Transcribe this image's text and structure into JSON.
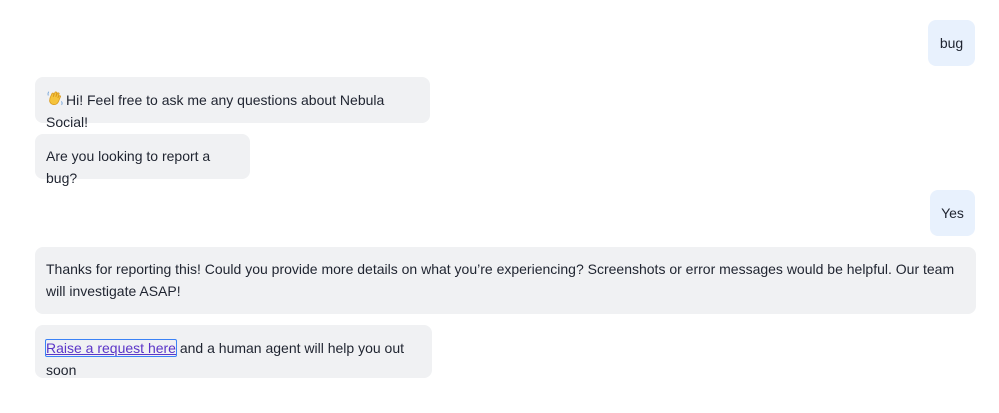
{
  "messages": {
    "user_bug": "bug",
    "bot_greeting": "Hi! Feel free to ask me any questions about Nebula Social!",
    "bot_question": "Are you looking to report a bug?",
    "user_yes": "Yes",
    "bot_thanks": "Thanks for reporting this! Could you provide more details on what you’re experiencing? Screenshots or error messages would be helpful. Our team will investigate ASAP!",
    "bot_request": {
      "link_label": "Raise a request here",
      "suffix": " and a human agent will help you out soon"
    }
  },
  "icons": {
    "greeting_icon": "waving-hand-icon"
  },
  "colors": {
    "bot_bubble": "#f0f1f3",
    "user_bubble": "#e8f1fd",
    "link": "#5b35c8",
    "focus_outline": "#3b82f6"
  }
}
